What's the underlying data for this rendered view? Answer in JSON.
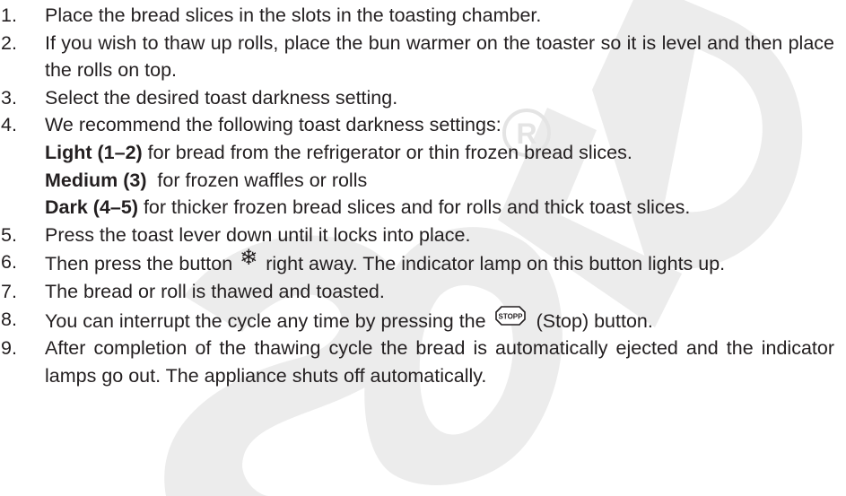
{
  "steps": [
    {
      "num": "1.",
      "text": "Place the bread slices in the slots in the toasting chamber."
    },
    {
      "num": "2.",
      "text": "If you wish to thaw up rolls, place the bun warmer on the toaster so it is level and then place the rolls on top."
    },
    {
      "num": "3.",
      "text": "Select the desired toast darkness setting."
    },
    {
      "num": "4.",
      "text": "We recommend the following toast darkness settings:",
      "settings": [
        {
          "label": "Light (1–2)",
          "desc": " for bread from the refrigerator or thin frozen bread slices."
        },
        {
          "label": "Medium (3)",
          "desc": "  for frozen waffles or rolls"
        },
        {
          "label": "Dark (4–5)",
          "desc": " for thicker frozen bread slices and for rolls and thick toast slices."
        }
      ]
    },
    {
      "num": "5.",
      "text": "Press the toast lever down until it locks into place."
    },
    {
      "num": "6.",
      "text_before": "Then press the button",
      "icon": "snowflake-defrost-icon",
      "text_after": "right away. The indicator lamp on this button lights up."
    },
    {
      "num": "7.",
      "text": "The bread or roll is thawed and toasted."
    },
    {
      "num": "8.",
      "text_before": "You can interrupt the cycle any time by pressing the",
      "icon_label": "STOPP",
      "text_after": "(Stop) button."
    },
    {
      "num": "9.",
      "text": "After completion of the thawing cycle the bread is automatically ejected and the indicator lamps go out. The appliance shuts off automatically."
    }
  ],
  "watermark": {
    "text": "SOLD",
    "mark": "®",
    "color": "#ececec"
  },
  "snowflake_glyph": "❄"
}
